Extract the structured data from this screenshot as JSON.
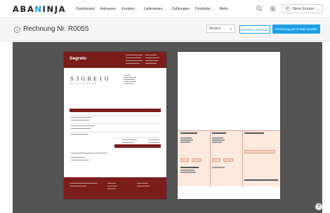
{
  "app": {
    "logo_prefix": "ABA",
    "logo_accent": "N",
    "logo_suffix": "INJA"
  },
  "nav": {
    "items": [
      {
        "label": "Dashboard",
        "dropdown": false
      },
      {
        "label": "Adressen",
        "dropdown": false
      },
      {
        "label": "Kunden",
        "dropdown": true
      },
      {
        "label": "Lieferanten",
        "dropdown": true
      },
      {
        "label": "Zahlungen",
        "dropdown": false
      },
      {
        "label": "Produkte",
        "dropdown": true
      },
      {
        "label": "Mehr",
        "dropdown": true
      }
    ]
  },
  "toolbar": {
    "user_label": "Silvio Stricker"
  },
  "invoice": {
    "title": "Rechnung Nr. R0055",
    "design_value": "Modern",
    "preview_button": "Vorschau schliessen",
    "email_button": "Rechnung per E-Mail senden"
  },
  "document": {
    "brand": "Segreto",
    "logo_text": "S3GRE1O",
    "logo_sub": "RISTORANTE"
  },
  "help": {
    "label": "?"
  },
  "colors": {
    "accent": "#1aa0e8",
    "brand_dark_red": "#7b1d1a",
    "preview_bg": "#555555",
    "slip_bg": "#fde9de"
  }
}
